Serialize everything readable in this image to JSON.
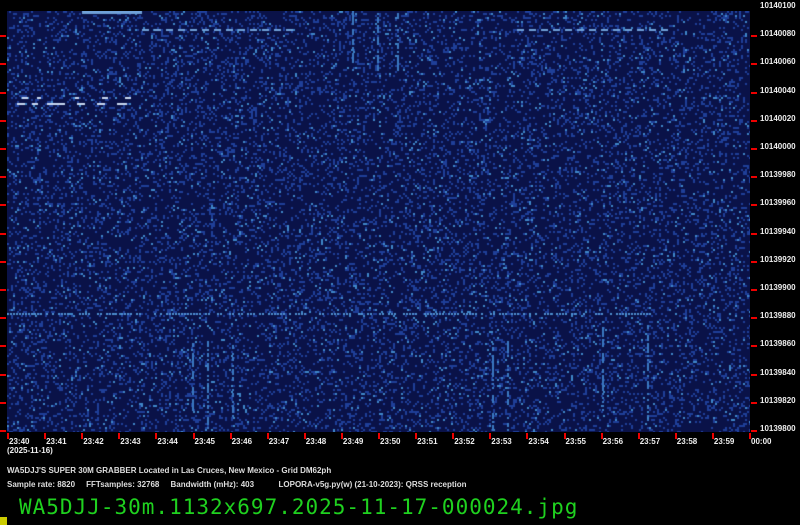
{
  "freq_labels": [
    "10140100",
    "10140080",
    "10140060",
    "10140040",
    "10140020",
    "10140000",
    "10139980",
    "10139960",
    "10139940",
    "10139920",
    "10139900",
    "10139880",
    "10139860",
    "10139840",
    "10139820",
    "10139800"
  ],
  "time_labels": [
    "23:40",
    "23:41",
    "23:42",
    "23:43",
    "23:44",
    "23:45",
    "23:46",
    "23:47",
    "23:48",
    "23:49",
    "23:50",
    "23:51",
    "23:52",
    "23:53",
    "23:54",
    "23:55",
    "23:56",
    "23:57",
    "23:58",
    "23:59",
    "00:00"
  ],
  "date_label": "(2025-11-16)",
  "station_line": "WA5DJJ'S SUPER 30M GRABBER Located in Las Cruces, New Mexico - Grid DM62ph",
  "settings_line": "Sample rate: 8820     FFTsamples: 32768     Bandwidth (mHz): 403           LOPORA-v5g.py(w) (21-10-2023): QRSS reception",
  "filename": "WA5DJJ-30m.1132x697.2025-11-17-000024.jpg",
  "colors": {
    "background": "#0a1248",
    "noise": "#2b5fb0",
    "tick": "#e00000",
    "filename": "#1fd11f"
  }
}
